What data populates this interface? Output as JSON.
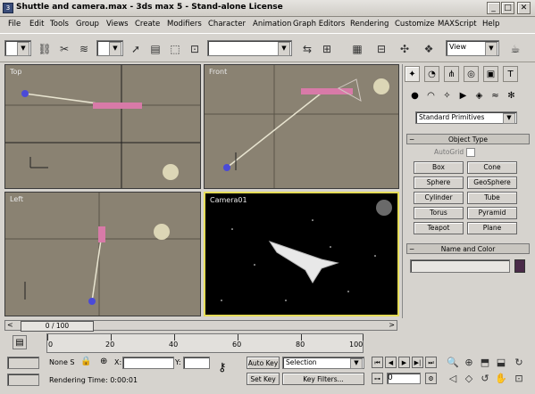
{
  "window": {
    "title": "Shuttle and camera.max - 3ds max 5 - Stand-alone License",
    "app_icon": "3ds-max-icon",
    "minimize": "_",
    "maximize": "□",
    "close": "✕"
  },
  "menu": [
    "File",
    "Edit",
    "Tools",
    "Group",
    "Views",
    "Create",
    "Modifiers",
    "Character",
    "Animation",
    "Graph Editors",
    "Rendering",
    "Customize",
    "MAXScript",
    "Help"
  ],
  "toolbar": {
    "selection_filter": "",
    "named_selection": "",
    "view_dropdown": "View"
  },
  "viewports": {
    "top": "Top",
    "front": "Front",
    "left": "Left",
    "camera": "Camera01"
  },
  "command_panel": {
    "category_dropdown": "Standard Primitives",
    "object_type": {
      "title": "Object Type",
      "autogrid": "AutoGrid",
      "buttons": [
        "Box",
        "Cone",
        "Sphere",
        "GeoSphere",
        "Cylinder",
        "Tube",
        "Torus",
        "Pyramid",
        "Teapot",
        "Plane"
      ]
    },
    "name_color": {
      "title": "Name and Color",
      "name_value": "",
      "color": "#4a2a48"
    }
  },
  "timeline": {
    "slider_label": "0 / 100",
    "ruler_labels": [
      "0",
      "20",
      "40",
      "60",
      "80",
      "100"
    ]
  },
  "status": {
    "selection_text": "None S",
    "x_label": "X:",
    "x_value": "",
    "y_label": "Y:",
    "y_value": "",
    "rendering_time": "Rendering Time: 0:00:01",
    "autokey": "Auto Key",
    "setkey": "Set Key",
    "selection_dropdown": "Selection",
    "key_filters": "Key Filters...",
    "frame_value": "0"
  }
}
